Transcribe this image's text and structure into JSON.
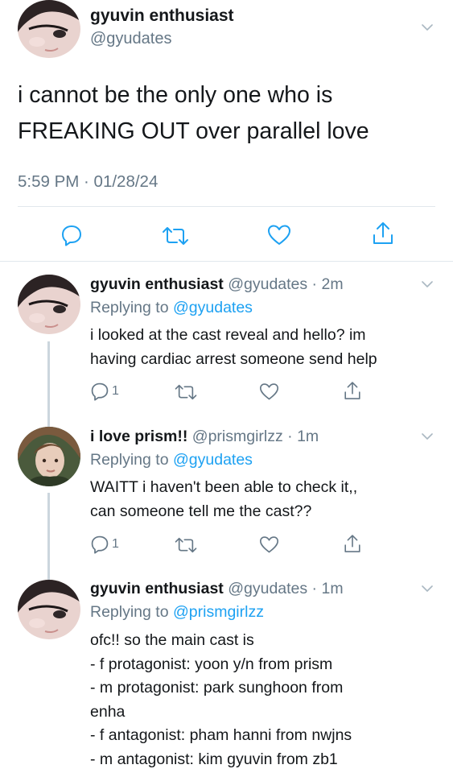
{
  "main_tweet": {
    "name": "gyuvin enthusiast",
    "handle": "@gyudates",
    "text_line1": "i cannot be the only one who is",
    "text_line2": "FREAKING OUT over parallel love",
    "timestamp": "5:59 PM · 01/28/24",
    "icons": [
      "reply-icon",
      "retweet-icon",
      "like-icon",
      "share-icon"
    ]
  },
  "replies": [
    {
      "name": "gyuvin enthusiast",
      "handle_time": "@gyudates · 2m",
      "replying_prefix": "Replying to ",
      "replying_to": "@gyudates",
      "lines": [
        "i looked at the cast reveal and hello? im",
        "having cardiac arrest someone send help"
      ],
      "reply_count": "1"
    },
    {
      "name": "i love prism!!",
      "handle_time": "@prismgirlzz · 1m",
      "replying_prefix": "Replying to ",
      "replying_to": "@gyudates",
      "lines": [
        "WAITT i haven't been able to check it,,",
        "can someone tell me the cast??"
      ],
      "reply_count": "1"
    },
    {
      "name": "gyuvin enthusiast",
      "handle_time": "@gyudates · 1m",
      "replying_prefix": "Replying to ",
      "replying_to": "@prismgirlzz",
      "lines": [
        "ofc!! so the main cast is",
        "- f protagonist: yoon y/n from prism",
        "- m protagonist: park sunghoon from",
        "enha",
        "- f antagonist: pham hanni from nwjns",
        "- m antagonist: kim gyuvin from zb1"
      ]
    }
  ],
  "colors": {
    "text": "#14171a",
    "secondary": "#657786",
    "link": "#1da1f2",
    "divider": "#e1e8ed"
  }
}
